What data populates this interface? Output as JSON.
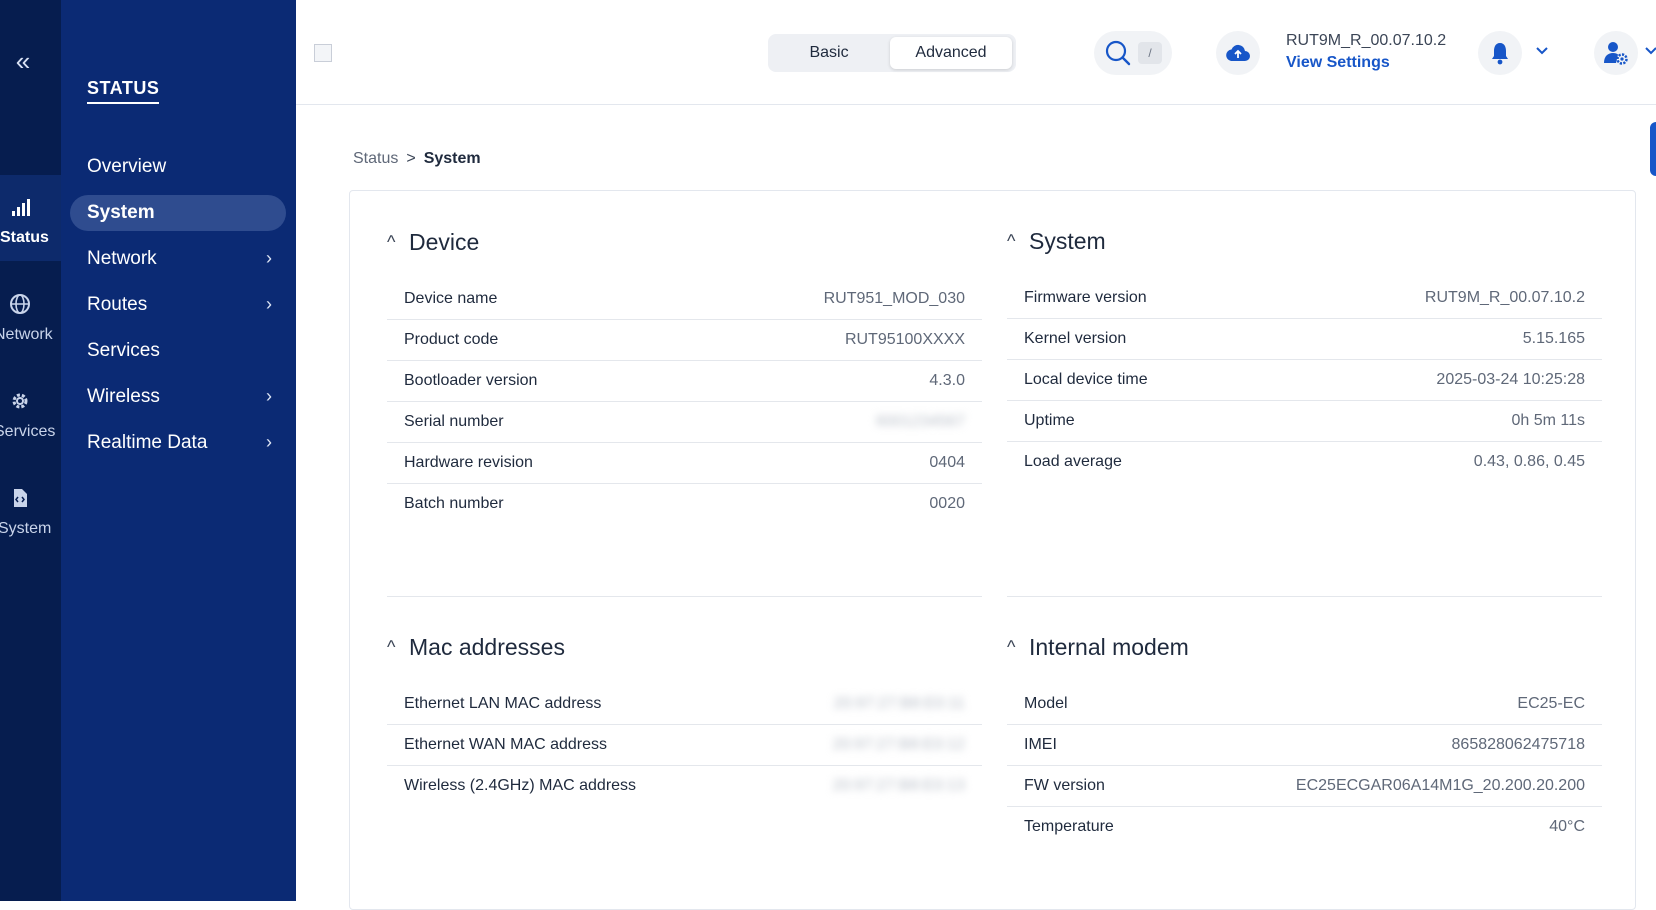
{
  "rail": {
    "collapse_icon": "double-chevron-left-icon",
    "items": [
      {
        "label": "Status",
        "icon": "signal-bars-icon",
        "active": true
      },
      {
        "label": "Network",
        "icon": "globe-icon"
      },
      {
        "label": "Services",
        "icon": "gear-icon"
      },
      {
        "label": "System",
        "icon": "file-code-icon"
      }
    ]
  },
  "nav": {
    "section": "STATUS",
    "items": [
      {
        "label": "Overview"
      },
      {
        "label": "System",
        "active": true
      },
      {
        "label": "Network",
        "submenu": true
      },
      {
        "label": "Routes",
        "submenu": true
      },
      {
        "label": "Services"
      },
      {
        "label": "Wireless",
        "submenu": true
      },
      {
        "label": "Realtime Data",
        "submenu": true
      }
    ]
  },
  "header": {
    "mode": {
      "basic": "Basic",
      "advanced": "Advanced",
      "selected": "Advanced"
    },
    "search_shortcut": "/",
    "firmware": "RUT9M_R_00.07.10.2",
    "view_settings": "View Settings"
  },
  "breadcrumb": {
    "parent": "Status",
    "separator": ">",
    "current": "System"
  },
  "panels": {
    "device": {
      "title": "Device",
      "rows": [
        {
          "label": "Device name",
          "value": "RUT951_MOD_030"
        },
        {
          "label": "Product code",
          "value": "RUT95100XXXX"
        },
        {
          "label": "Bootloader version",
          "value": "4.3.0"
        },
        {
          "label": "Serial number",
          "value": "6001234567"
        },
        {
          "label": "Hardware revision",
          "value": "0404"
        },
        {
          "label": "Batch number",
          "value": "0020"
        }
      ]
    },
    "system": {
      "title": "System",
      "rows": [
        {
          "label": "Firmware version",
          "value": "RUT9M_R_00.07.10.2"
        },
        {
          "label": "Kernel version",
          "value": "5.15.165"
        },
        {
          "label": "Local device time",
          "value": "2025-03-24 10:25:28"
        },
        {
          "label": "Uptime",
          "value": "0h 5m 11s"
        },
        {
          "label": "Load average",
          "value": "0.43, 0.86, 0.45"
        }
      ]
    },
    "mac": {
      "title": "Mac addresses",
      "rows": [
        {
          "label": "Ethernet LAN MAC address",
          "value": "20:97:27:B8:E0:11"
        },
        {
          "label": "Ethernet WAN MAC address",
          "value": "20:97:27:B8:E0:12"
        },
        {
          "label": "Wireless (2.4GHz) MAC address",
          "value": "20:97:27:B8:E0:13"
        }
      ]
    },
    "modem": {
      "title": "Internal modem",
      "rows": [
        {
          "label": "Model",
          "value": "EC25-EC"
        },
        {
          "label": "IMEI",
          "value": "865828062475718"
        },
        {
          "label": "FW version",
          "value": "EC25ECGAR06A14M1G_20.200.20.200"
        },
        {
          "label": "Temperature",
          "value": "40°C"
        }
      ]
    }
  }
}
